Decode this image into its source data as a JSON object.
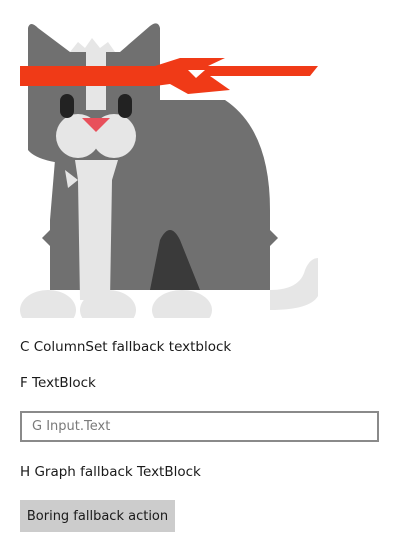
{
  "card": {
    "image": {
      "icon": "ninja-cat-image",
      "colors": {
        "fur": "#707070",
        "light_fur": "#e6e6e6",
        "shadow": "#3a3a3a",
        "headband": "#f03a17",
        "nose": "#e8505b",
        "eyes": "#222222"
      }
    },
    "column_set_fallback_text": "C ColumnSet fallback textblock",
    "textblock_f": "F TextBlock",
    "input": {
      "value": "",
      "placeholder": "G Input.Text"
    },
    "graph_fallback_text": "H Graph fallback TextBlock",
    "fallback_action_label": "Boring fallback action"
  }
}
